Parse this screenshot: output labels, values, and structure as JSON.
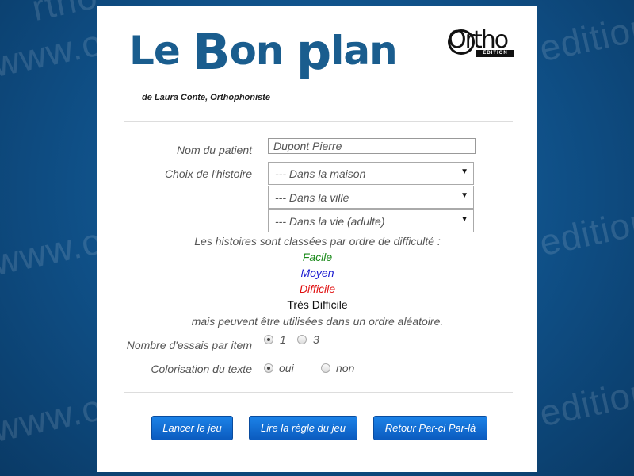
{
  "watermark": "www.orthoedition",
  "watermark_parts": [
    "www.o",
    "rtho",
    "edition",
    "www.o",
    "edition",
    "www.o",
    "edition"
  ],
  "header": {
    "title_letters": [
      "Le ",
      "B",
      "on ",
      "p",
      "lan"
    ],
    "subtitle": "de Laura Conte, Orthophoniste",
    "brand": {
      "name": "Ortho",
      "sub": "ÉDITION"
    }
  },
  "form": {
    "patient_label": "Nom du patient",
    "patient_value": "Dupont Pierre",
    "story_label": "Choix de l'histoire",
    "selects": [
      "--- Dans la maison",
      "--- Dans la ville",
      "--- Dans la vie (adulte)"
    ],
    "info_intro": "Les histoires sont classées par ordre de difficulté :",
    "levels": [
      {
        "label": "Facile",
        "color": "#1a8a1a"
      },
      {
        "label": "Moyen",
        "color": "#1a1ad0"
      },
      {
        "label": "Difficile",
        "color": "#e01010"
      },
      {
        "label": "Très Difficile",
        "color": "#111111"
      }
    ],
    "info_outro": "mais peuvent être utilisées dans un ordre aléatoire.",
    "attempts_label": "Nombre d'essais par item",
    "attempts_options": [
      {
        "label": "1",
        "selected": true
      },
      {
        "label": "3",
        "selected": false
      }
    ],
    "color_label": "Colorisation du texte",
    "color_options": [
      {
        "label": "oui",
        "selected": true
      },
      {
        "label": "non",
        "selected": false
      }
    ]
  },
  "buttons": {
    "start": "Lancer le jeu",
    "rules": "Lire la règle du jeu",
    "back": "Retour Par-ci Par-là"
  },
  "colors": {
    "brand_blue": "#1a5d8e",
    "button_blue": "#1c83e8",
    "background": "#0f4f86"
  }
}
